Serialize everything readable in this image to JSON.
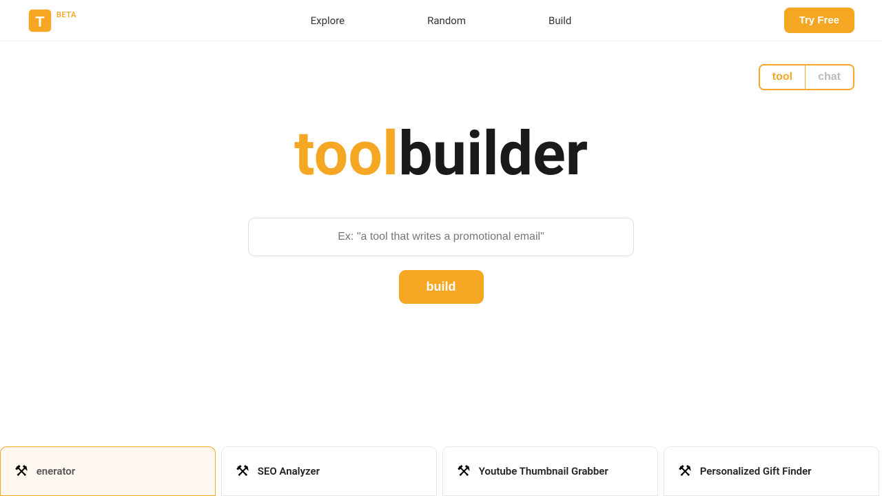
{
  "nav": {
    "logo_alt": "T",
    "beta_label": "BETA",
    "links": [
      {
        "label": "Explore",
        "name": "nav-explore"
      },
      {
        "label": "Random",
        "name": "nav-random"
      },
      {
        "label": "Build",
        "name": "nav-build"
      }
    ],
    "try_free_label": "Try Free"
  },
  "toggle": {
    "tool_label": "tool",
    "chat_label": "chat"
  },
  "hero": {
    "title_tool": "tool",
    "title_rest": "builder",
    "input_placeholder": "Ex: \"a tool that writes a promotional email\"",
    "build_label": "build"
  },
  "cards": [
    {
      "icon": "⚒",
      "title": "enerator",
      "partial": true
    },
    {
      "icon": "⚒",
      "title": "SEO Analyzer"
    },
    {
      "icon": "⚒",
      "title": "Youtube Thumbnail Grabber"
    },
    {
      "icon": "⚒",
      "title": "Personalized Gift Finder"
    }
  ],
  "colors": {
    "orange": "#f5a623",
    "dark": "#1a1a1a",
    "gray": "#999",
    "border": "#ddd"
  }
}
